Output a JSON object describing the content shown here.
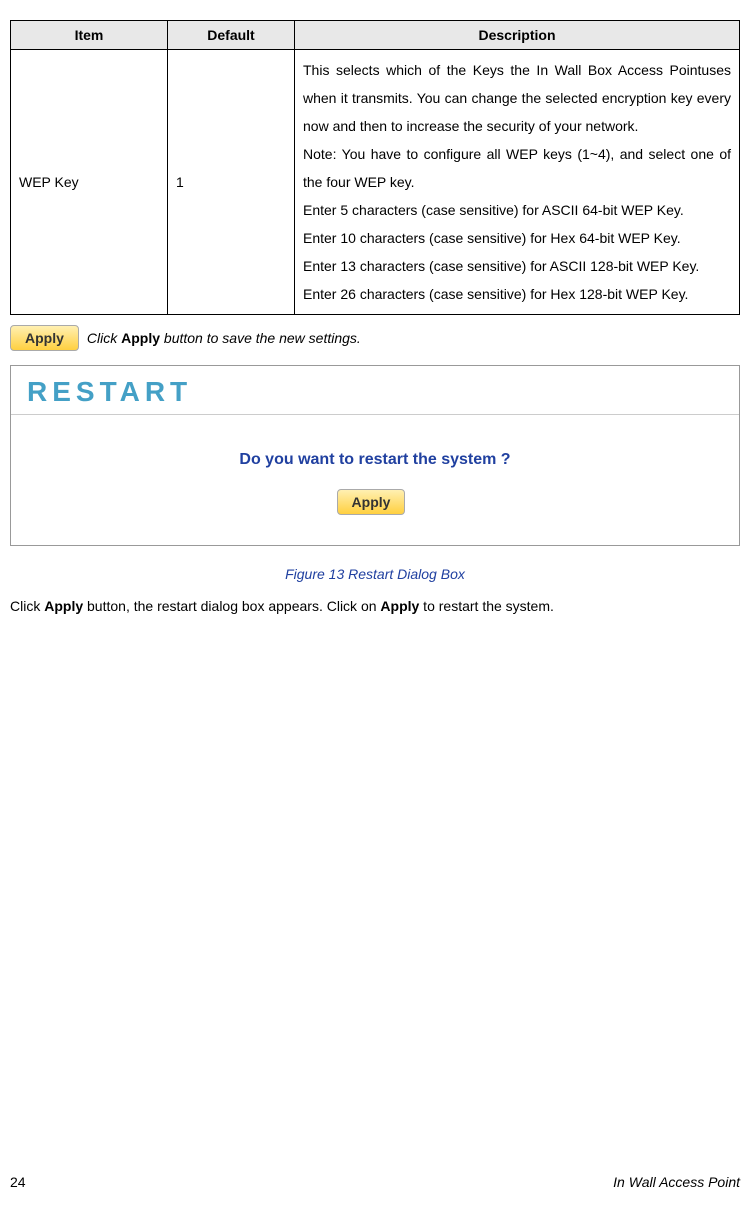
{
  "table": {
    "headers": {
      "item": "Item",
      "default": "Default",
      "description": "Description"
    },
    "rows": [
      {
        "item": "WEP Key",
        "default": "1",
        "description": "This selects which of the Keys the In Wall Box Access Pointuses when it transmits. You can change the selected encryption key every now and then to increase the security of your network.\nNote: You have to configure all WEP keys (1~4), and select one of the four WEP key.\nEnter 5 characters (case sensitive) for ASCII 64-bit WEP Key.\nEnter 10 characters (case sensitive) for Hex 64-bit WEP Key.\nEnter 13 characters (case sensitive) for ASCII 128-bit WEP Key.\nEnter 26 characters (case sensitive) for Hex 128-bit WEP Key."
      }
    ]
  },
  "apply": {
    "button_label": "Apply",
    "text_before": " Click ",
    "text_bold": "Apply",
    "text_after": " button to save the new settings."
  },
  "figure": {
    "restart_title": "RESTART",
    "question": "Do you want to restart the system ?",
    "apply_label": "Apply",
    "caption": "Figure 13 Restart Dialog Box"
  },
  "body_paragraph": {
    "t1": "Click ",
    "b1": "Apply",
    "t2": " button, the restart dialog box appears. Click on ",
    "b2": "Apply",
    "t3": " to restart the system."
  },
  "footer": {
    "page_number": "24",
    "doc_title": "In Wall Access Point"
  }
}
